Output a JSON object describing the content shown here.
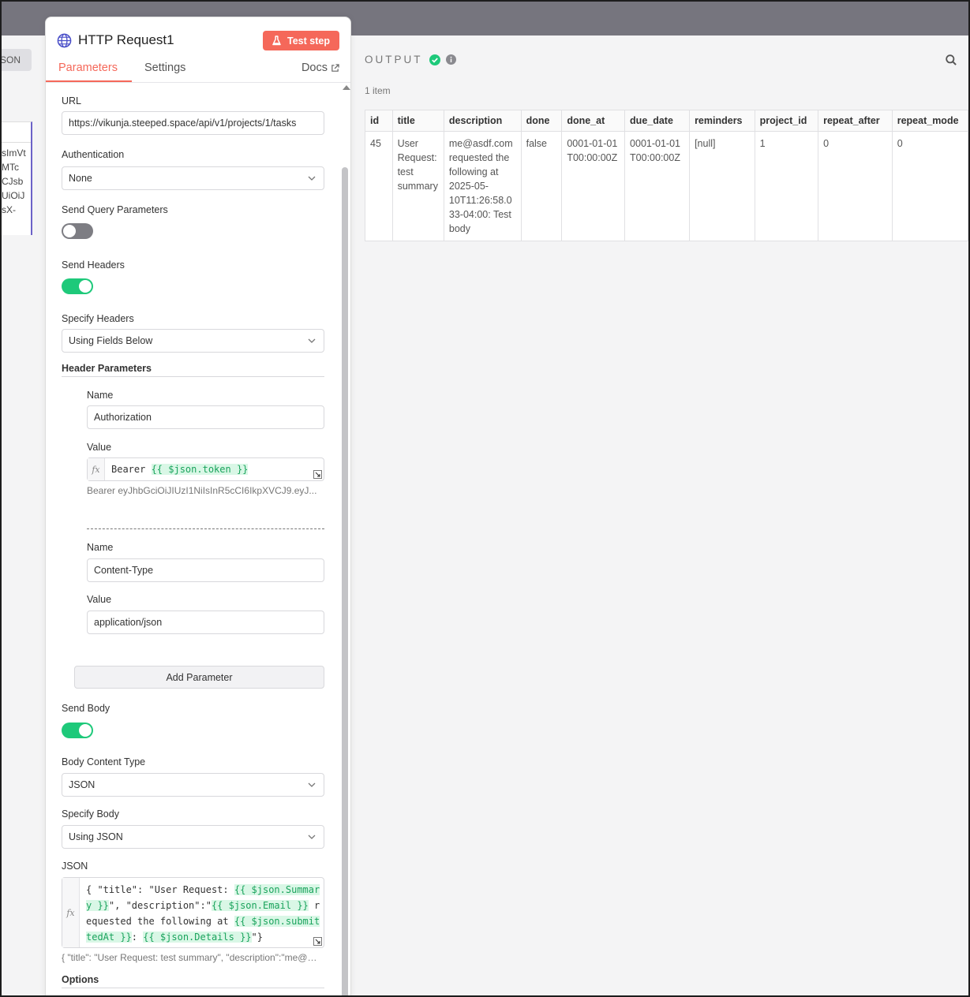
{
  "left_input": {
    "json_tab": "SON",
    "lines": [
      "sImVt",
      "MTc",
      "CJsb",
      "UiOiJ",
      "sX-"
    ]
  },
  "node": {
    "title": "HTTP Request1",
    "test_step": "Test step",
    "tabs": [
      "Parameters",
      "Settings"
    ],
    "docs": "Docs"
  },
  "params": {
    "url_label": "URL",
    "url_value": "https://vikunja.steeped.space/api/v1/projects/1/tasks",
    "auth_label": "Authentication",
    "auth_value": "None",
    "query_label": "Send Query Parameters",
    "headers_label": "Send Headers",
    "specify_headers_label": "Specify Headers",
    "specify_headers_value": "Using Fields Below",
    "header_params_label": "Header Parameters",
    "headers": [
      {
        "name_label": "Name",
        "name": "Authorization",
        "value_label": "Value",
        "value_prefix": "Bearer ",
        "value_expr": "{{ $json.token }}",
        "preview": "Bearer eyJhbGciOiJIUzI1NiIsInR5cCI6IkpXVCJ9.eyJ..."
      },
      {
        "name_label": "Name",
        "name": "Content-Type",
        "value_label": "Value",
        "value": "application/json"
      }
    ],
    "add_parameter": "Add Parameter",
    "send_body_label": "Send Body",
    "body_type_label": "Body Content Type",
    "body_type_value": "JSON",
    "specify_body_label": "Specify Body",
    "specify_body_value": "Using JSON",
    "json_label": "JSON",
    "json_code": {
      "p1": "{ \"title\": \"User Request: ",
      "e1a": "{{ $json.Summar",
      "e1b": "y }}",
      "p2": "\", \"description\":\"",
      "e2": "{{ $json.Email }}",
      "p3a": " r",
      "p3b": "equested the following at ",
      "e3a": "{{ $json.submit",
      "e3b": "tedAt }}",
      "p4": ": ",
      "e4": "{{ $json.Details }}",
      "p5": "\"}"
    },
    "json_preview": "{ \"title\": \"User Request: test summary\", \"description\":\"me@asdf.com requested the following at 2025-05-10T11:26:58.033-04:00: Test body\"}",
    "options_label": "Options"
  },
  "output": {
    "title": "OUTPUT",
    "count": "1 item",
    "columns": [
      "id",
      "title",
      "description",
      "done",
      "done_at",
      "due_date",
      "reminders",
      "project_id",
      "repeat_after",
      "repeat_mode"
    ],
    "row": [
      "45",
      "User Request: test summary",
      "me@asdf.com requested the following at 2025-05-10T11:26:58.033-04:00: Test body",
      "false",
      "0001-01-01T00:00:00Z",
      "0001-01-01T00:00:00Z",
      "[null]",
      "1",
      "0",
      "0"
    ]
  },
  "colors": {
    "accent": "#f5685a",
    "success": "#1ec97a",
    "toggle_off": "#7d7d83"
  }
}
